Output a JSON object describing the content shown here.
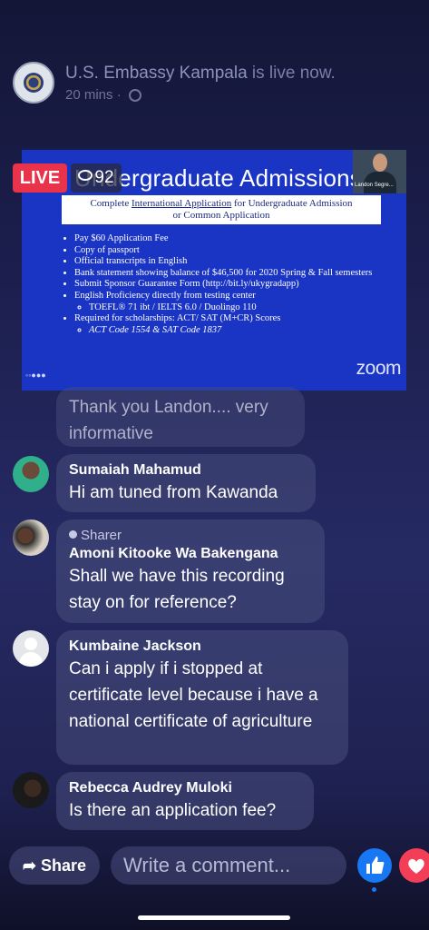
{
  "header": {
    "page_name": "U.S. Embassy Kampala",
    "status": "is live now.",
    "time": "20 mins"
  },
  "video": {
    "slide_title": "Undergraduate Admissions",
    "subtitle_pre": "Complete ",
    "subtitle_link": "International Application",
    "subtitle_post": " for Undergraduate Admission",
    "subtitle_line2": "or Common Application",
    "bullets": [
      "Pay $60 Application Fee",
      "Copy of passport",
      "Official transcripts in English",
      "Bank statement showing balance of $46,500 for 2020 Spring & Fall semesters",
      "Submit Sponsor Guarantee Form (http://bit.ly/ukygradapp)",
      "English Proficiency directly from testing center",
      "Required for scholarships: ACT/ SAT (M+CR) Scores"
    ],
    "sub_bullet_1": "TOEFL® 71 ibt  /  IELTS 6.0  / Duolingo 110",
    "sub_bullet_2": "ACT Code 1554 & SAT Code 1837",
    "webcam_name": "Landon Segre...",
    "zoom_label": "zoom"
  },
  "live_badge": "LIVE",
  "viewer_count": "92",
  "comments": [
    {
      "name": "",
      "text": "Thank you Landon.... very informative"
    },
    {
      "name": "Sumaiah Mahamud",
      "text": "Hi am tuned from Kawanda"
    },
    {
      "badge": "Sharer",
      "name": "Amoni Kitooke Wa Bakengana",
      "text": "Shall we have this recording stay on for reference?"
    },
    {
      "name": "Kumbaine Jackson",
      "text": "Can i apply if i stopped at certificate level because i have a national certificate of agriculture"
    },
    {
      "name": "Rebecca Audrey Muloki",
      "text": "Is there an application fee?"
    }
  ],
  "bottom_bar": {
    "share_label": "Share",
    "comment_placeholder": "Write a comment..."
  },
  "colors": {
    "live_red": "#e8334a",
    "slide_blue": "#1a34c4",
    "like_blue": "#1877f2",
    "love_red": "#f33e58"
  }
}
